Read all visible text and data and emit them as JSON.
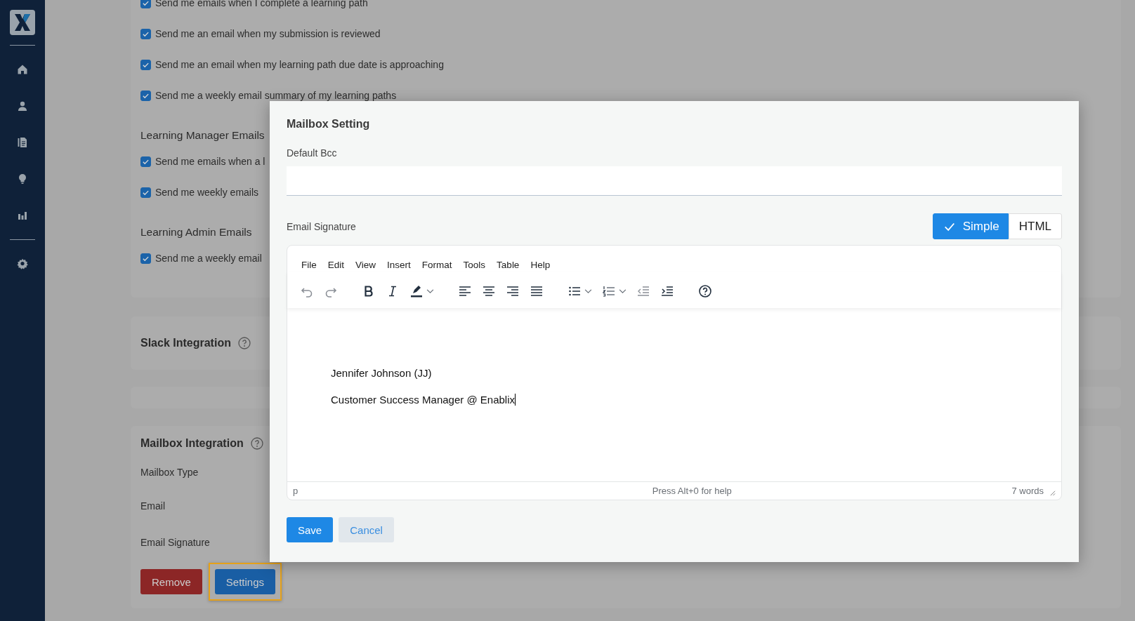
{
  "notification_groups": [
    {
      "options": [
        {
          "label": "Send me emails when I complete a learning path",
          "checked": true
        },
        {
          "label": "Send me an email when my submission is reviewed",
          "checked": true
        },
        {
          "label": "Send me an email when my learning path due date is approaching",
          "checked": true
        },
        {
          "label": "Send me a weekly email summary of my learning paths",
          "checked": true
        }
      ]
    },
    {
      "heading": "Learning Manager Emails",
      "options": [
        {
          "label": "Send me emails when a l",
          "checked": true
        },
        {
          "label": "Send me weekly emails",
          "checked": true
        }
      ]
    },
    {
      "heading": "Learning Admin Emails",
      "options": [
        {
          "label": "Send me a weekly email",
          "checked": true
        }
      ]
    }
  ],
  "slack_integration": {
    "title": "Slack Integration"
  },
  "mailbox_integration": {
    "title": "Mailbox Integration",
    "fields": [
      "Mailbox Type",
      "Email",
      "Email Signature"
    ],
    "buttons": [
      {
        "label": "Remove",
        "kind": "danger",
        "focused": false
      },
      {
        "label": "Settings",
        "kind": "primary",
        "focused": true
      }
    ]
  },
  "dialog": {
    "title": "Mailbox Setting",
    "default_bcc": {
      "label": "Default Bcc"
    },
    "email_signature": {
      "label": "Email Signature",
      "modes": [
        {
          "label": "Simple",
          "selected": true
        },
        {
          "label": "HTML",
          "selected": false
        }
      ],
      "editor": {
        "menu": [
          "File",
          "Edit",
          "View",
          "Insert",
          "Format",
          "Tools",
          "Table",
          "Help"
        ],
        "toolbar": [
          [
            {
              "kind": "undo",
              "disabled": true
            },
            {
              "kind": "redo",
              "disabled": true
            }
          ],
          [
            {
              "kind": "bold",
              "disabled": false
            },
            {
              "kind": "italic",
              "disabled": false
            },
            {
              "kind": "highlight",
              "disabled": false,
              "split": true
            }
          ],
          [
            {
              "kind": "align-left",
              "disabled": false
            },
            {
              "kind": "align-center",
              "disabled": false
            },
            {
              "kind": "align-right",
              "disabled": false
            },
            {
              "kind": "justify",
              "disabled": false
            }
          ],
          [
            {
              "kind": "bullet-list",
              "disabled": false,
              "split": true
            },
            {
              "kind": "numbered-list",
              "disabled": false,
              "split": true
            },
            {
              "kind": "outdent",
              "disabled": true
            },
            {
              "kind": "indent",
              "disabled": false
            }
          ],
          [
            {
              "kind": "help",
              "disabled": false
            }
          ]
        ],
        "content": [
          "Jennifer Johnson (JJ)",
          "Customer Success Manager @ Enablix"
        ],
        "path": "p",
        "help": "Press Alt+0 for help",
        "word_count": "7 words"
      }
    },
    "buttons": [
      {
        "label": "Save",
        "kind": "primary"
      },
      {
        "label": "Cancel",
        "kind": "secondary"
      }
    ]
  }
}
